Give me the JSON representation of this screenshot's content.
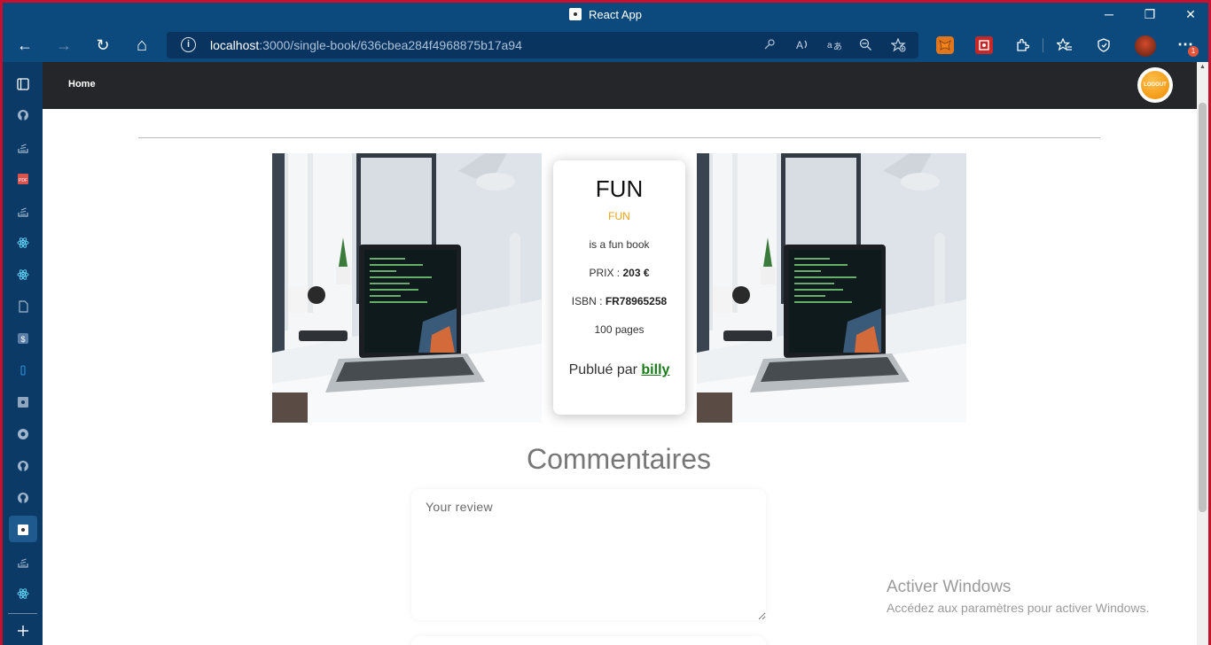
{
  "window": {
    "title": "React App",
    "controls": {
      "minimize": "─",
      "restore": "❐",
      "close": "✕"
    }
  },
  "browser": {
    "url_host": "localhost",
    "url_path": ":3000/single-book/636cbea284f4968875b17a94",
    "info_glyph": "i",
    "back_glyph": "←",
    "forward_glyph": "→",
    "refresh_glyph": "↻",
    "home_glyph": "⌂",
    "more_glyph": "⋯",
    "badge_count": "1",
    "accent_color": "#0c4a7e"
  },
  "app": {
    "nav": {
      "home": "Home"
    },
    "logout_label": "LOGOUT"
  },
  "book": {
    "title": "FUN",
    "genre": "FUN",
    "description": "is a fun book",
    "price_label": "PRIX : ",
    "price_value": "203 €",
    "isbn_label": "ISBN : ",
    "isbn_value": "FR78965258",
    "pages": "100 pages",
    "published_by_label": "Publué par ",
    "author": "billy"
  },
  "comments": {
    "heading": "Commentaires",
    "review_placeholder": "Your review"
  },
  "os_watermark": {
    "line1": "Activer Windows",
    "line2": "Accédez aux paramètres pour activer Windows."
  }
}
